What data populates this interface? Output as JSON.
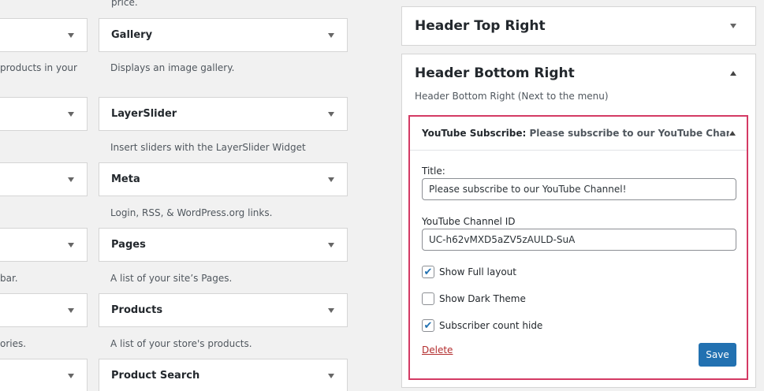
{
  "left_column": {
    "top_fragment": "price.",
    "widgets": [
      {
        "name": "Gallery",
        "desc": "Displays an image gallery."
      },
      {
        "name": "LayerSlider",
        "desc": "Insert sliders with the LayerSlider Widget"
      },
      {
        "name": "Meta",
        "desc": "Login, RSS, & WordPress.org links."
      },
      {
        "name": "Pages",
        "desc": "A list of your site’s Pages."
      },
      {
        "name": "Products",
        "desc": "A list of your store's products."
      },
      {
        "name": "Product Search",
        "desc": ""
      }
    ],
    "far_left_desc": [
      "products in your",
      "",
      "",
      "bar.",
      "ories."
    ]
  },
  "sidebars": {
    "header_top_right": {
      "title": "Header Top Right"
    },
    "header_bottom_right": {
      "title": "Header Bottom Right",
      "desc": "Header Bottom Right (Next to the menu)"
    }
  },
  "yt_widget": {
    "head_title": "YouTube Subscribe:",
    "head_sub": " Please subscribe to our YouTube Chan...",
    "title_label": "Title:",
    "title_value": "Please subscribe to our YouTube Channel!",
    "channel_label": "YouTube Channel ID",
    "channel_value": "UC-h62vMXD5aZV5zAULD-SuA",
    "checkboxes": [
      {
        "label": "Show Full layout",
        "checked": true
      },
      {
        "label": "Show Dark Theme",
        "checked": false
      },
      {
        "label": "Subscriber count hide",
        "checked": true
      }
    ],
    "delete_label": "Delete",
    "save_label": "Save"
  },
  "colors": {
    "accent": "#2271b1",
    "highlight_border": "#d43a64",
    "delete": "#b32d2e"
  }
}
